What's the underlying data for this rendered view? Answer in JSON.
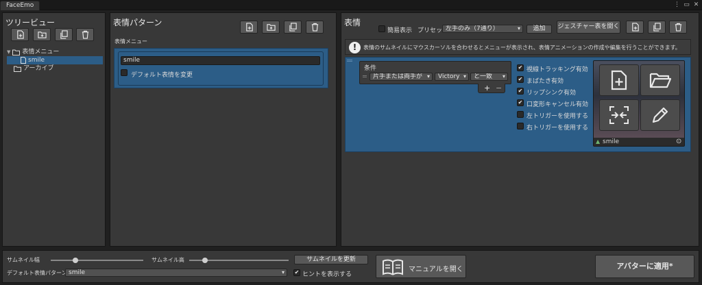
{
  "window": {
    "tab_title": "FaceEmo"
  },
  "tree": {
    "title": "ツリービュー",
    "items": [
      {
        "label": "表情メニュー"
      },
      {
        "label": "smile"
      },
      {
        "label": "アーカイブ"
      }
    ]
  },
  "pattern": {
    "title": "表情パターン",
    "menu_label": "表情メニュー",
    "item_name": "smile",
    "default_change_label": "デフォルト表情を変更"
  },
  "expression": {
    "title": "表情",
    "simple_display_label": "簡易表示",
    "preset_label": "プリセット",
    "preset_value": "左手のみ（7通り）",
    "add_label": "追加",
    "open_gesture_table_label": "ジェスチャー表を開く",
    "hint_text": "表情のサムネイルにマウスカーソルを合わせるとメニューが表示され、表情アニメーションの作成や編集を行うことができます。",
    "condition": {
      "header": "条件",
      "hand": "片手または両手が",
      "gesture": "Victory",
      "comparison": "と一致",
      "plus": "+",
      "minus": "−"
    },
    "options": [
      {
        "label": "視線トラッキング有効",
        "checked": true
      },
      {
        "label": "まばたき有効",
        "checked": true
      },
      {
        "label": "リップシンク有効",
        "checked": true
      },
      {
        "label": "口変形キャンセル有効",
        "checked": true
      },
      {
        "label": "左トリガーを使用する",
        "checked": false
      },
      {
        "label": "右トリガーを使用する",
        "checked": false
      }
    ],
    "thumbnail_label": "smile"
  },
  "footer": {
    "thumb_width_label": "サムネイル幅",
    "thumb_height_label": "サムネイル高",
    "thumb_width_value": 0.12,
    "thumb_height_value": 0.12,
    "update_thumbnail_label": "サムネイルを更新",
    "default_pattern_label": "デフォルト表情パターン",
    "default_pattern_value": "smile",
    "show_hints_label": "ヒントを表示する",
    "open_manual_label": "マニュアルを開く",
    "apply_label": "アバターに適用*"
  }
}
